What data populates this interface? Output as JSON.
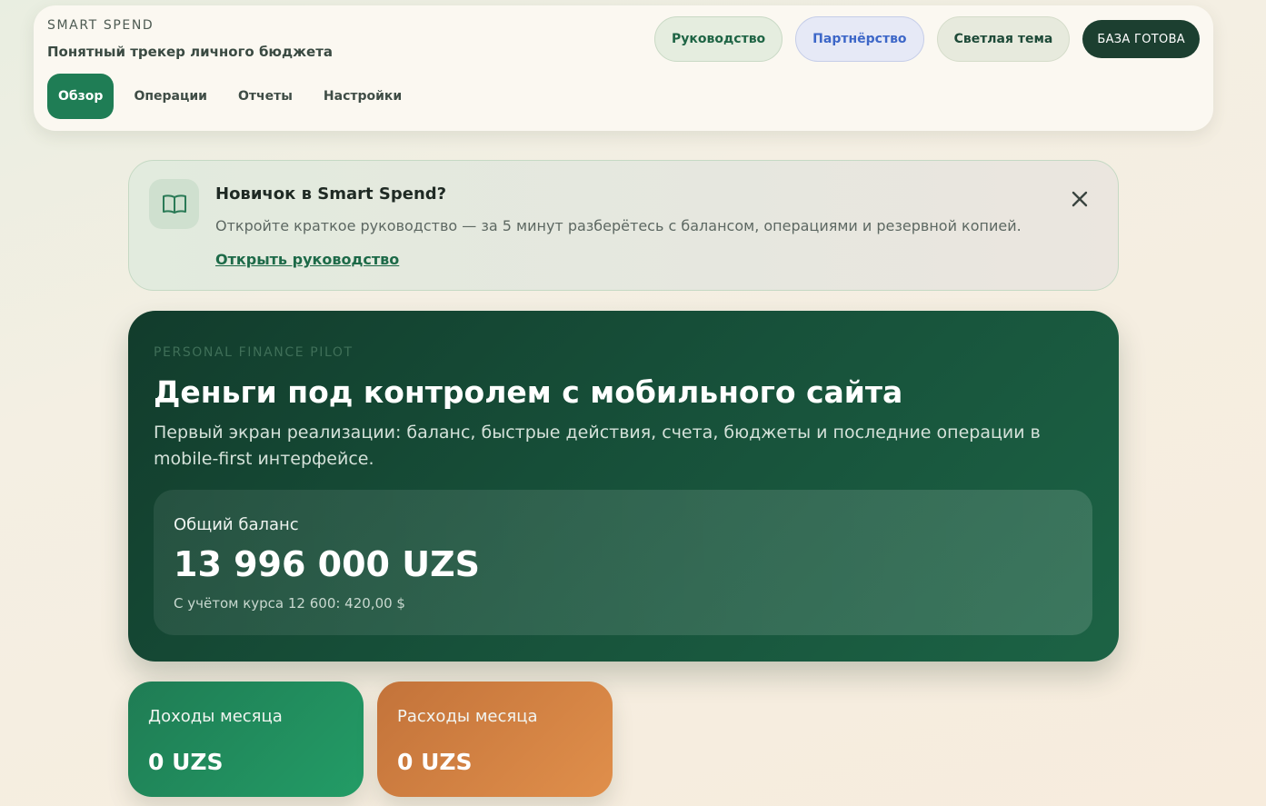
{
  "header": {
    "brand": "SMART SPEND",
    "tagline": "Понятный трекер личного бюджета",
    "nav": [
      {
        "label": "Обзор",
        "active": true
      },
      {
        "label": "Операции",
        "active": false
      },
      {
        "label": "Отчеты",
        "active": false
      },
      {
        "label": "Настройки",
        "active": false
      }
    ],
    "actions": {
      "guide": "Руководство",
      "partnership": "Партнёрство",
      "theme": "Светлая тема",
      "status": "БАЗА ГОТОВА"
    }
  },
  "banner": {
    "icon": "book-icon",
    "title": "Новичок в Smart Spend?",
    "text": "Откройте краткое руководство — за 5 минут разберётесь с балансом, операциями и резервной копией.",
    "link": "Открыть руководство",
    "close_icon": "close-icon"
  },
  "hero": {
    "kicker": "PERSONAL FINANCE PILOT",
    "title": "Деньги под контролем с мобильного сайта",
    "description": "Первый экран реализации: баланс, быстрые действия, счета, бюджеты и последние операции в mobile-first интерфейсе.",
    "balance": {
      "label": "Общий баланс",
      "value": "13 996 000 UZS",
      "note": "С учётом курса 12 600: 420,00 $"
    }
  },
  "stats": {
    "income": {
      "label": "Доходы месяца",
      "value": "0 UZS"
    },
    "expense": {
      "label": "Расходы месяца",
      "value": "0 UZS"
    }
  },
  "colors": {
    "accent": "#1f7d55",
    "hero_bg": "#17513a",
    "status_bg": "#1c3f30",
    "expense": "#d5833f",
    "partner_text": "#3d67c8"
  }
}
